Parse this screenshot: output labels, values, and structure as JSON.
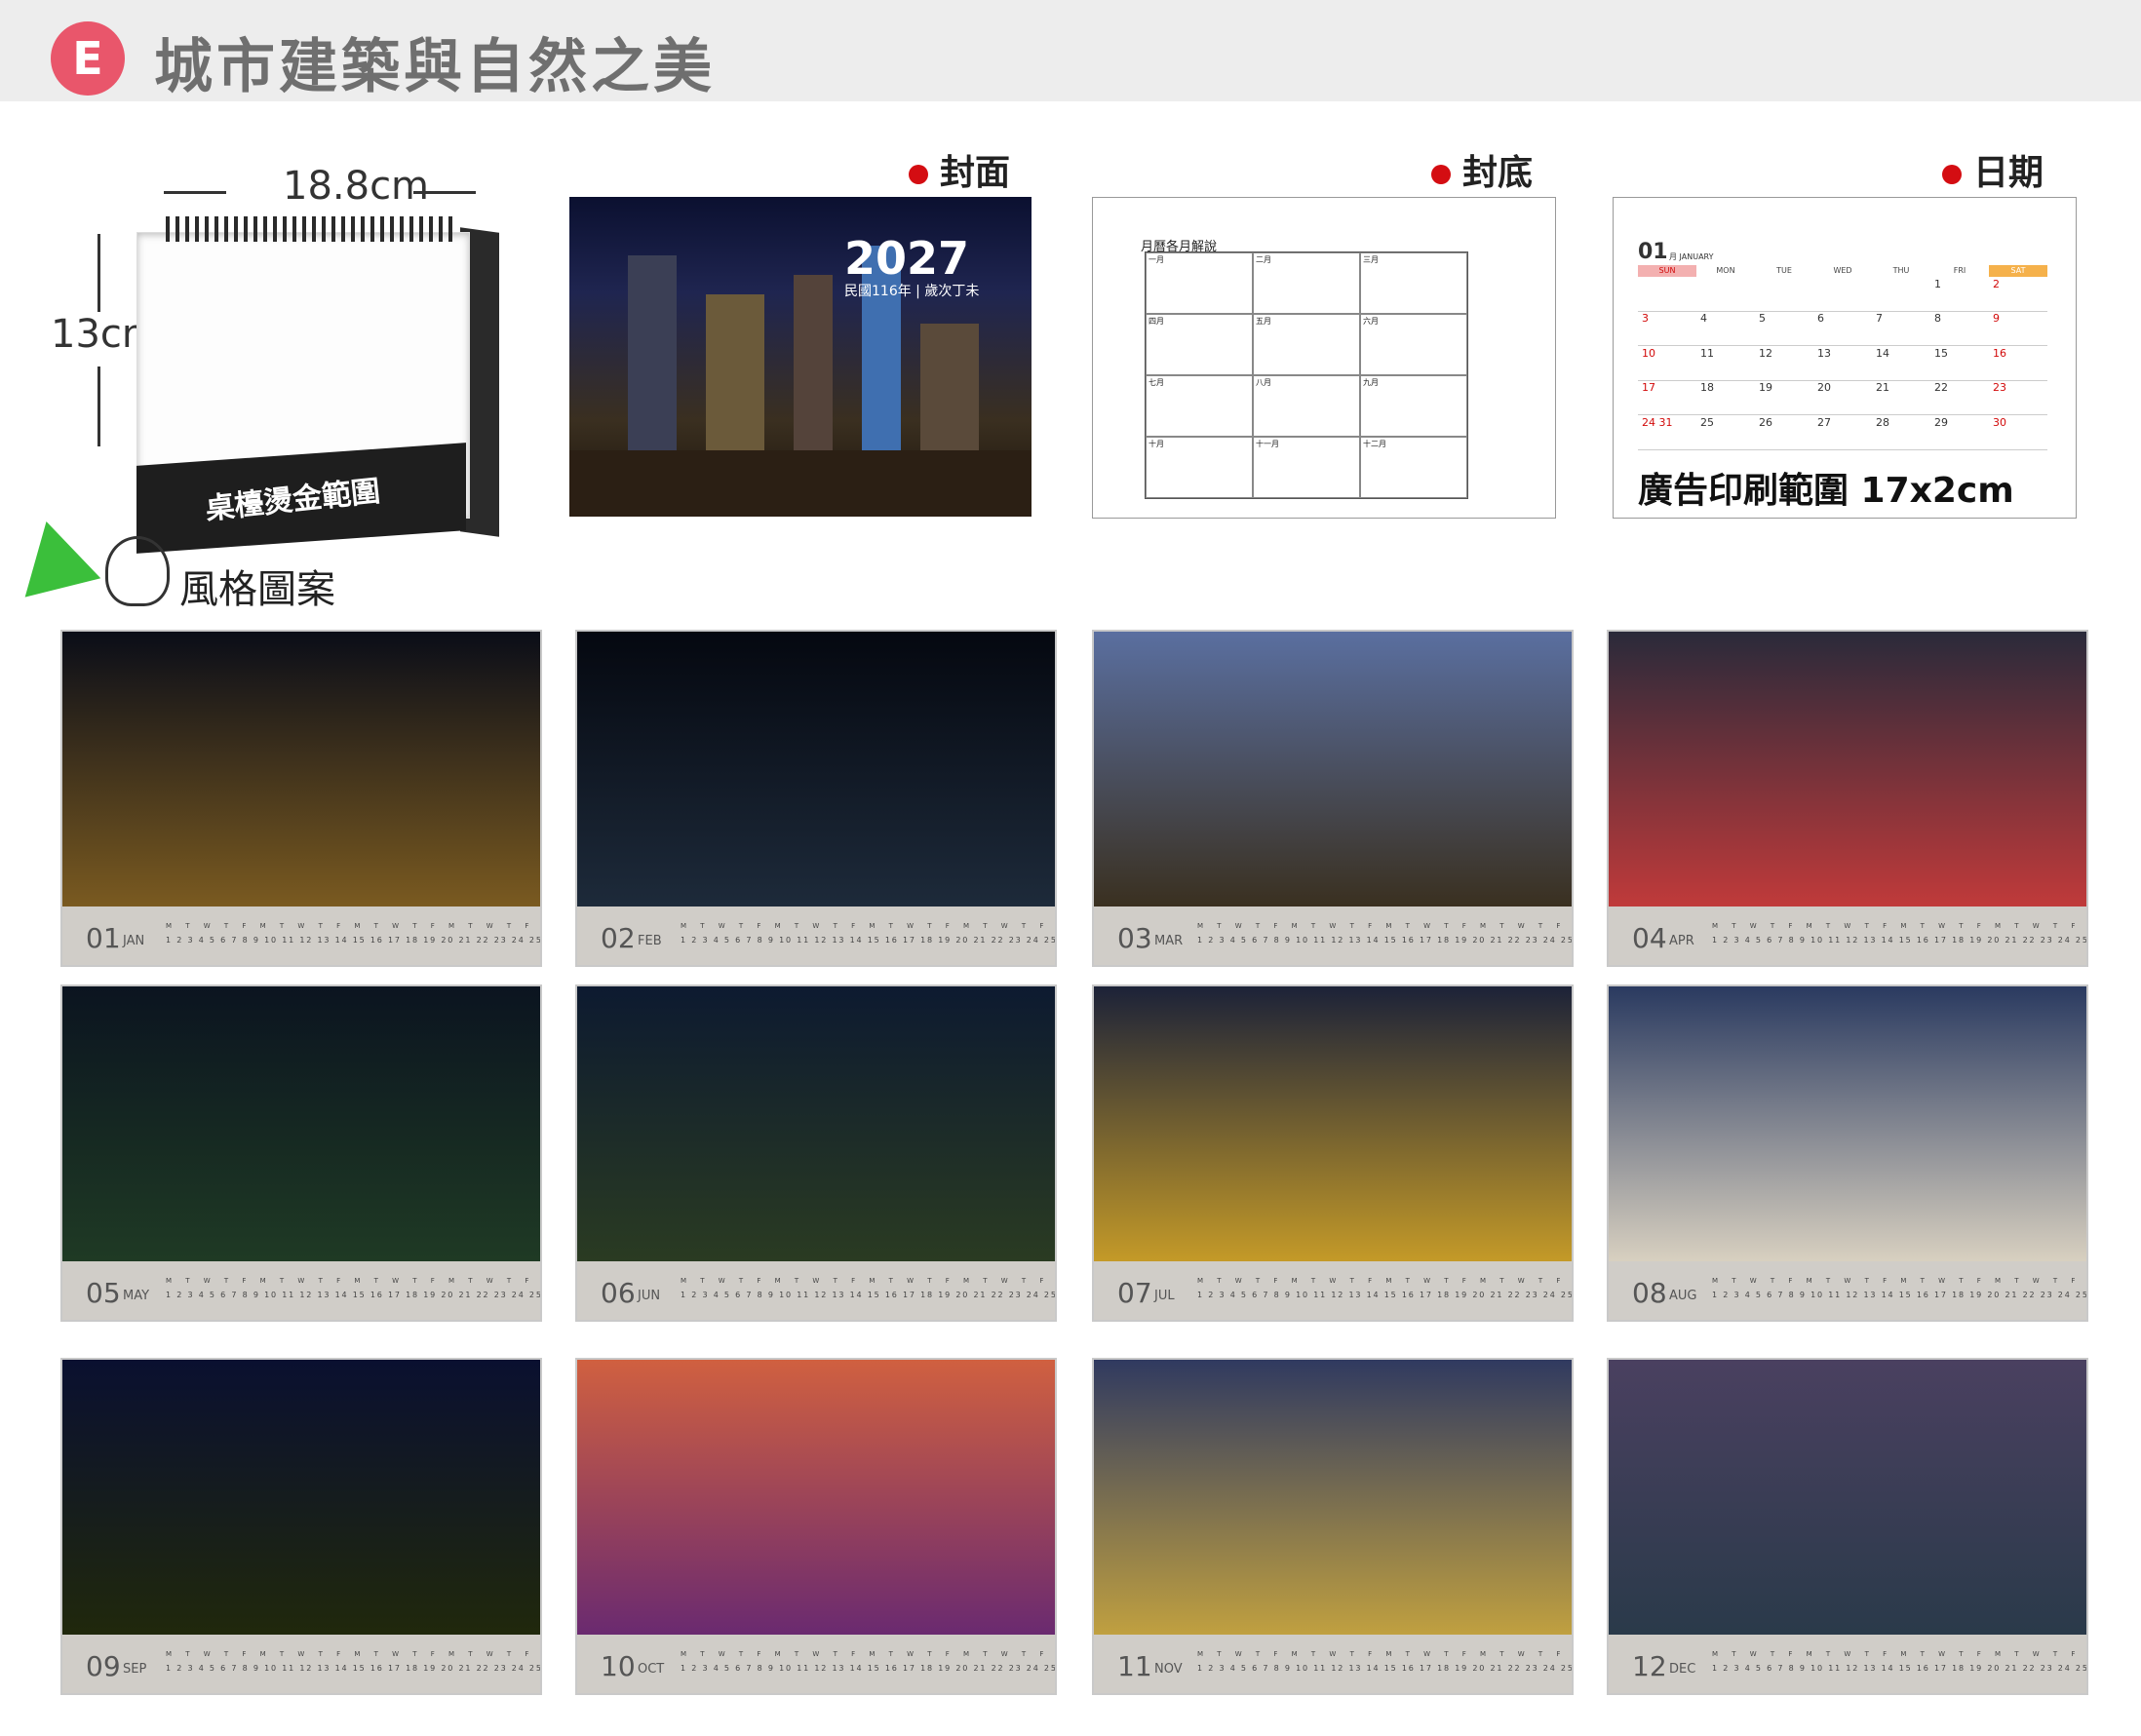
{
  "header": {
    "badge": "E",
    "title": "城市建築與自然之美"
  },
  "desk": {
    "width_label": "18.8cm",
    "height_label": "13cm",
    "base_label": "桌檯燙金範圍"
  },
  "sections": {
    "cover": "封面",
    "back": "封底",
    "date": "日期",
    "style": "風格圖案"
  },
  "colors": {
    "accent": "#d40d12",
    "badge": "#e9566b",
    "sunday": "#d20a0a",
    "saturday_header": "#f5b14b"
  },
  "cover": {
    "year": "2027",
    "subtitle": "民國116年 | 歲次丁未"
  },
  "back_cover": {
    "heading": "月曆各月解說",
    "cells": [
      "一月",
      "二月",
      "三月",
      "四月",
      "五月",
      "六月",
      "七月",
      "八月",
      "九月",
      "十月",
      "十一月",
      "十二月"
    ]
  },
  "date_page": {
    "month_num": "01",
    "month_name": "月 JANUARY",
    "weekdays": [
      "SUN",
      "MON",
      "TUE",
      "WED",
      "THU",
      "FRI",
      "SAT"
    ],
    "rows": [
      [
        "",
        "",
        "",
        "",
        "",
        "1",
        "2"
      ],
      [
        "3",
        "4",
        "5",
        "6",
        "7",
        "8",
        "9"
      ],
      [
        "10",
        "11",
        "12",
        "13",
        "14",
        "15",
        "16"
      ],
      [
        "17",
        "18",
        "19",
        "20",
        "21",
        "22",
        "23"
      ],
      [
        "24 31",
        "25",
        "26",
        "27",
        "28",
        "29",
        "30"
      ]
    ],
    "ad_label": "廣告印刷範圍 17x2cm"
  },
  "months": [
    {
      "num": "01",
      "name": "JAN"
    },
    {
      "num": "02",
      "name": "FEB"
    },
    {
      "num": "03",
      "name": "MAR"
    },
    {
      "num": "04",
      "name": "APR"
    },
    {
      "num": "05",
      "name": "MAY"
    },
    {
      "num": "06",
      "name": "JUN"
    },
    {
      "num": "07",
      "name": "JUL"
    },
    {
      "num": "08",
      "name": "AUG"
    },
    {
      "num": "09",
      "name": "SEP"
    },
    {
      "num": "10",
      "name": "OCT"
    },
    {
      "num": "11",
      "name": "NOV"
    },
    {
      "num": "12",
      "name": "DEC"
    }
  ]
}
